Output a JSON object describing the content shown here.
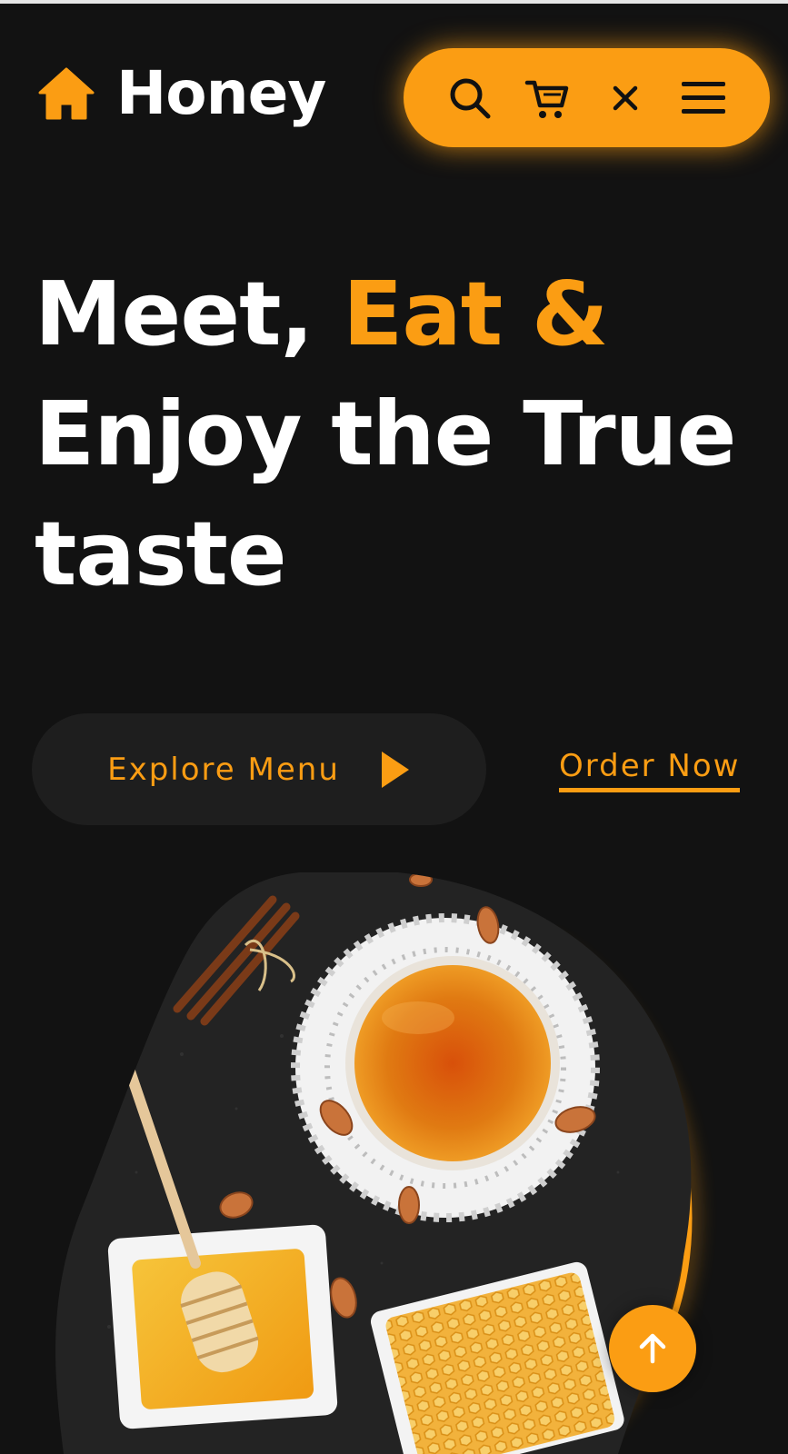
{
  "header": {
    "brand": "Honey",
    "icons": [
      "home-icon",
      "search-icon",
      "cart-icon",
      "close-icon",
      "menu-icon"
    ]
  },
  "hero": {
    "title_part1": "Meet, ",
    "title_accent": "Eat &",
    "title_line2": "Enjoy the True",
    "title_line3": "taste"
  },
  "actions": {
    "explore_label": "Explore Menu",
    "order_label": "Order Now"
  },
  "colors": {
    "accent": "#fb9d13",
    "background": "#121212",
    "button_bg": "#1e1e1e"
  }
}
